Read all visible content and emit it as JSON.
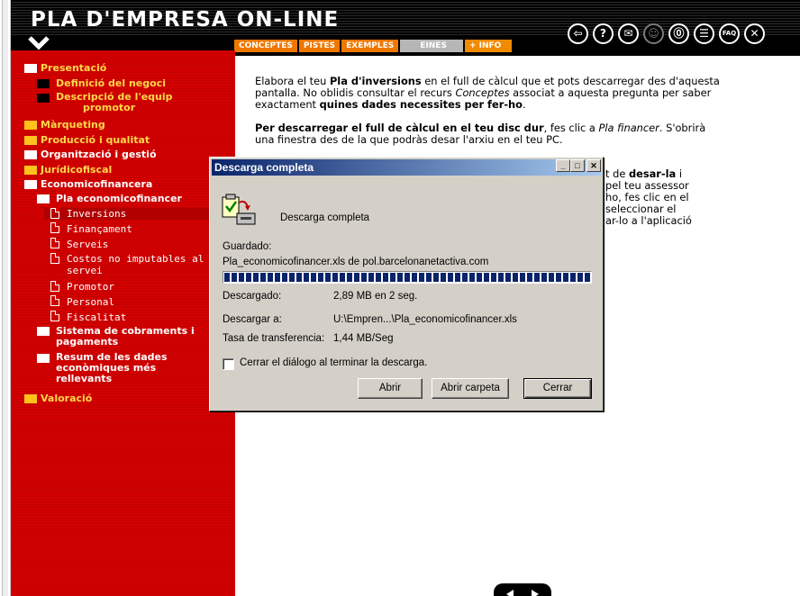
{
  "app": {
    "title": "PLA D'EMPRESA ON-LINE"
  },
  "header_icons": [
    {
      "name": "back-icon",
      "glyph": "⎋"
    },
    {
      "name": "help-icon",
      "glyph": "?"
    },
    {
      "name": "mail-icon",
      "glyph": "✉"
    },
    {
      "name": "user-icon",
      "glyph": "♙",
      "disabled": true
    },
    {
      "name": "attach-icon",
      "glyph": "⊘"
    },
    {
      "name": "notes-icon",
      "glyph": "▤"
    },
    {
      "name": "faq-icon",
      "glyph": "FAQ"
    },
    {
      "name": "close-icon",
      "glyph": "✕"
    }
  ],
  "tabs": {
    "conceptes": "CONCEPTES",
    "pistes": "PISTES",
    "exemples": "EXEMPLES",
    "eines": "EINES",
    "info": "+ INFO"
  },
  "sidebar": {
    "presentacio": "Presentació",
    "definicio": "Definició del negoci",
    "descripcio_1": "Descripció de l'equip",
    "descripcio_2": "promotor",
    "marqueting": "Màrqueting",
    "produccio": "Producció i qualitat",
    "organitzacio": "Organització i gestió",
    "juridicofiscal": "Jurídicofiscal",
    "economicofinancera": "Economicofinancera",
    "pla_eco": "Pla economicofinancer",
    "inversions": "Inversions",
    "financament": "Finançament",
    "serveis": "Serveis",
    "costos_1": "Costos no imputables al",
    "costos_2": "servei",
    "promotor": "Promotor",
    "personal": "Personal",
    "fiscalitat": "Fiscalitat",
    "sistema_1": "Sistema de cobraments i",
    "sistema_2": "pagaments",
    "resum_1": "Resum de les dades",
    "resum_2": "econòmiques més",
    "resum_3": "rellevants",
    "valoracio": "Valoració"
  },
  "content": {
    "p1_a": "Elabora el teu ",
    "p1_b": "Pla d'inversions",
    "p1_c": " en el full de càlcul que et pots descarregar des d'aquesta pantalla. No oblidis consultar el recurs ",
    "p1_d": "Conceptes",
    "p1_e": " associat a aquesta pregunta per saber exactament ",
    "p1_f": "quines dades necessites per fer-ho",
    "p1_g": ".",
    "p2_a": "Per descarregar el full de càlcul en el teu disc dur",
    "p2_b": ", fes clic a ",
    "p2_c": "Pla financer",
    "p2_d": ". S'obrirà una finestra des de la que podràs desar l'arxiu en el teu PC.",
    "p3_l1_a": "t de ",
    "p3_l1_b": "desar-la",
    "p3_l1_c": " i",
    "p3_l2": "pel teu assessor",
    "p3_l3": "ho, fes clic en el",
    "p3_l4": "seleccionar el",
    "p3_l5": "ar-lo a l'aplicació"
  },
  "dialog": {
    "title": "Descarga completa",
    "heading": "Descarga completa",
    "saved_label": "Guardado:",
    "saved_value": "Pla_economicofinancer.xls de pol.barcelonanetactiva.com",
    "progress": 1.0,
    "downloaded_label": "Descargado:",
    "downloaded_value": "2,89 MB en 2 seg.",
    "download_to_label": "Descargar a:",
    "download_to_value": "U:\\Empren...\\Pla_economicofinancer.xls",
    "rate_label": "Tasa de transferencia:",
    "rate_value": "1,44 MB/Seg",
    "checkbox_label": "Cerrar el diálogo al terminar la descarga.",
    "checkbox_checked": false,
    "btn_open": "Abrir",
    "btn_open_folder": "Abrir carpeta",
    "btn_close": "Cerrar"
  }
}
